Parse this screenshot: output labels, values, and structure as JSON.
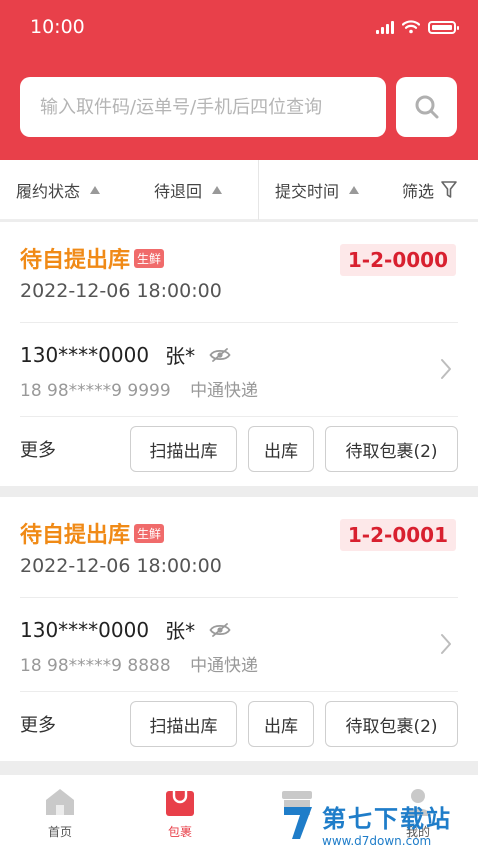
{
  "status_bar": {
    "time": "10:00"
  },
  "search": {
    "placeholder": "输入取件码/运单号/手机后四位查询"
  },
  "filters": [
    {
      "label": "履约状态"
    },
    {
      "label": "待退回"
    },
    {
      "label": "提交时间"
    },
    {
      "label": "筛选"
    }
  ],
  "orders": [
    {
      "status": "待自提出库",
      "tag": "生鲜",
      "shelf_code": "1-2-0000",
      "datetime": "2022-12-06 18:00:00",
      "phone": "130****0000",
      "name": "张*",
      "tracking": "18 98*****9 9999",
      "carrier": "中通快递",
      "more": "更多",
      "actions": {
        "scan_out": "扫描出库",
        "out": "出库",
        "pending": "待取包裹(2)"
      }
    },
    {
      "status": "待自提出库",
      "tag": "生鲜",
      "shelf_code": "1-2-0001",
      "datetime": "2022-12-06 18:00:00",
      "phone": "130****0000",
      "name": "张*",
      "tracking": "18 98*****9 8888",
      "carrier": "中通快递",
      "more": "更多",
      "actions": {
        "scan_out": "扫描出库",
        "out": "出库",
        "pending": "待取包裹(2)"
      }
    }
  ],
  "tabbar": {
    "home": "首页",
    "packages": "包裹",
    "me": "我的"
  },
  "watermark": {
    "title": "第七下载站",
    "url": "www.d7down.com"
  },
  "colors": {
    "primary": "#e8404a",
    "status_orange": "#f08a16",
    "shelf_red": "#d8202f",
    "watermark_blue": "#1f7dc9"
  },
  "icons": {
    "search": "search-icon",
    "hide": "eye-off-icon",
    "filter": "funnel-icon",
    "chevron": "chevron-right-icon",
    "home": "home-icon",
    "bag": "bag-icon",
    "shop": "shop-icon",
    "user": "user-icon"
  }
}
